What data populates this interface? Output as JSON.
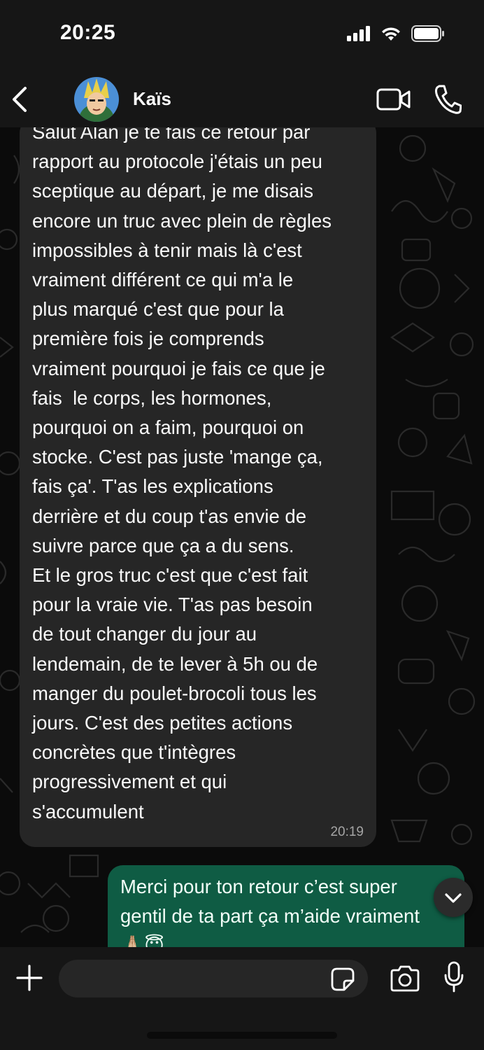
{
  "status_bar": {
    "time": "20:25",
    "icons": [
      "signal-icon",
      "wifi-icon",
      "battery-icon"
    ]
  },
  "header": {
    "contact_name": "Kaïs",
    "icons": [
      "back-icon",
      "avatar",
      "video-call-icon",
      "phone-icon"
    ]
  },
  "messages": [
    {
      "direction": "incoming",
      "text": "Salut Alan je te fais ce retour par\nrapport au protocole j'étais un peu\nsceptique au départ, je me disais\nencore un truc avec plein de règles\nimpossibles à tenir mais là c'est\nvraiment différent ce qui m'a le\nplus marqué c'est que pour la\npremière fois je comprends\nvraiment pourquoi je fais ce que je\nfais  le corps, les hormones,\npourquoi on a faim, pourquoi on\nstocke. C'est pas juste 'mange ça,\nfais ça'. T'as les explications\nderrière et du coup t'as envie de\nsuivre parce que ça a du sens.\nEt le gros truc c'est que c'est fait\npour la vraie vie. T'as pas besoin\nde tout changer du jour au\nlendemain, de te lever à 5h ou de\nmanger du poulet-brocoli tous les\njours. C'est des petites actions\nconcrètes que t'intègres\nprogressivement et qui\ns'accumulent",
      "time": "20:19"
    },
    {
      "direction": "outgoing",
      "text": "Merci pour ton retour c’est super\ngentil de ta part ça m’aide vraiment\n🙏🏼😇"
    }
  ],
  "input": {
    "placeholder": ""
  },
  "colors": {
    "bar_background": "#161616",
    "chat_background": "#0b0b0b",
    "incoming_bubble": "#262626",
    "outgoing_bubble": "#0f5c44"
  }
}
